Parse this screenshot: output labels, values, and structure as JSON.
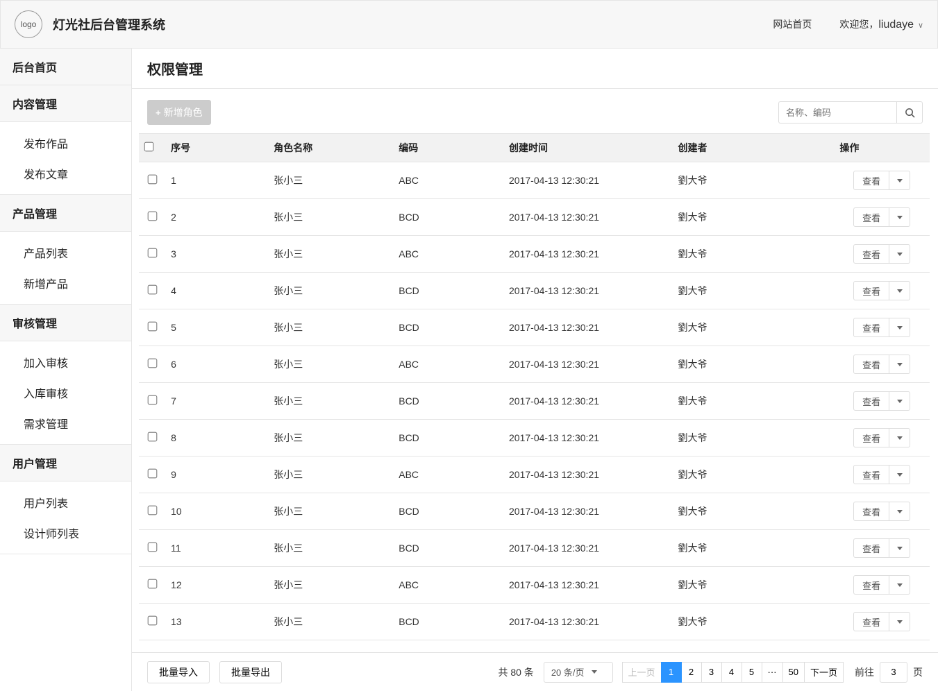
{
  "header": {
    "logo_text": "logo",
    "app_title": "灯光社后台管理系统",
    "site_link": "网站首页",
    "welcome_prefix": "欢迎您，",
    "username": "liudaye"
  },
  "sidebar": {
    "home": "后台首页",
    "groups": [
      {
        "heading": "内容管理",
        "items": [
          "发布作品",
          "发布文章"
        ]
      },
      {
        "heading": "产品管理",
        "items": [
          "产品列表",
          "新增产品"
        ]
      },
      {
        "heading": "审核管理",
        "items": [
          "加入审核",
          "入库审核",
          "需求管理"
        ]
      },
      {
        "heading": "用户管理",
        "items": [
          "用户列表",
          "设计师列表"
        ]
      }
    ]
  },
  "page": {
    "title": "权限管理",
    "add_button": "新增角色",
    "search_placeholder": "名称、编码"
  },
  "table": {
    "columns": {
      "idx": "序号",
      "name": "角色名称",
      "code": "编码",
      "time": "创建时间",
      "creator": "创建者",
      "action": "操作"
    },
    "view_label": "查看",
    "rows": [
      {
        "idx": "1",
        "name": "张小三",
        "code": "ABC",
        "time": "2017-04-13 12:30:21",
        "creator": "劉大爷"
      },
      {
        "idx": "2",
        "name": "张小三",
        "code": "BCD",
        "time": "2017-04-13 12:30:21",
        "creator": "劉大爷"
      },
      {
        "idx": "3",
        "name": "张小三",
        "code": "ABC",
        "time": "2017-04-13 12:30:21",
        "creator": "劉大爷"
      },
      {
        "idx": "4",
        "name": "张小三",
        "code": "BCD",
        "time": "2017-04-13 12:30:21",
        "creator": "劉大爷"
      },
      {
        "idx": "5",
        "name": "张小三",
        "code": "BCD",
        "time": "2017-04-13 12:30:21",
        "creator": "劉大爷"
      },
      {
        "idx": "6",
        "name": "张小三",
        "code": "ABC",
        "time": "2017-04-13 12:30:21",
        "creator": "劉大爷"
      },
      {
        "idx": "7",
        "name": "张小三",
        "code": "BCD",
        "time": "2017-04-13 12:30:21",
        "creator": "劉大爷"
      },
      {
        "idx": "8",
        "name": "张小三",
        "code": "BCD",
        "time": "2017-04-13 12:30:21",
        "creator": "劉大爷"
      },
      {
        "idx": "9",
        "name": "张小三",
        "code": "ABC",
        "time": "2017-04-13 12:30:21",
        "creator": "劉大爷"
      },
      {
        "idx": "10",
        "name": "张小三",
        "code": "BCD",
        "time": "2017-04-13 12:30:21",
        "creator": "劉大爷"
      },
      {
        "idx": "11",
        "name": "张小三",
        "code": "BCD",
        "time": "2017-04-13 12:30:21",
        "creator": "劉大爷"
      },
      {
        "idx": "12",
        "name": "张小三",
        "code": "ABC",
        "time": "2017-04-13 12:30:21",
        "creator": "劉大爷"
      },
      {
        "idx": "13",
        "name": "张小三",
        "code": "BCD",
        "time": "2017-04-13 12:30:21",
        "creator": "劉大爷"
      }
    ]
  },
  "footer": {
    "batch_import": "批量导入",
    "batch_export": "批量导出",
    "total_prefix": "共 ",
    "total_count": "80",
    "total_suffix": " 条",
    "page_size": "20 条/页",
    "prev": "上一页",
    "next": "下一页",
    "pages": [
      "1",
      "2",
      "3",
      "4",
      "5",
      "···",
      "50"
    ],
    "active_page": "1",
    "goto_prefix": "前往",
    "goto_value": "3",
    "goto_suffix": "页"
  }
}
